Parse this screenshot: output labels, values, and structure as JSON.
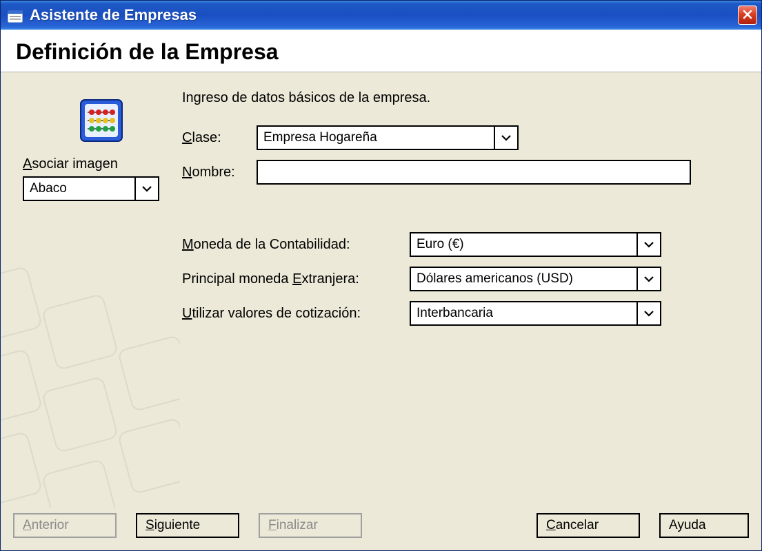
{
  "window": {
    "title": "Asistente de Empresas"
  },
  "header": {
    "heading": "Definición de la Empresa"
  },
  "content": {
    "subtitle": "Ingreso de datos básicos de la empresa.",
    "associate_image": {
      "label_pre": "A",
      "label_rest": "sociar imagen",
      "value": "Abaco",
      "icon_name": "abacus-icon"
    },
    "clase": {
      "label_pre": "C",
      "label_rest": "lase:",
      "value": "Empresa Hogareña"
    },
    "nombre": {
      "label_pre": "N",
      "label_rest": "ombre:",
      "value": ""
    },
    "moneda_contabilidad": {
      "label_pre": "M",
      "label_rest": "oneda de la Contabilidad:",
      "value": "Euro (€)"
    },
    "moneda_extranjera": {
      "label_text": "Principal moneda ",
      "label_ul": "E",
      "label_post": "xtranjera:",
      "value": "Dólares americanos (USD)"
    },
    "cotizacion": {
      "label_pre": "U",
      "label_rest": "tilizar valores de cotización:",
      "value": "Interbancaria"
    }
  },
  "buttons": {
    "anterior": {
      "ul": "A",
      "rest": "nterior",
      "enabled": false
    },
    "siguiente": {
      "ul": "S",
      "rest": "iguiente",
      "enabled": true
    },
    "finalizar": {
      "ul": "F",
      "rest": "inalizar",
      "enabled": false
    },
    "cancelar": {
      "ul": "C",
      "rest": "ancelar",
      "enabled": true
    },
    "ayuda": {
      "ul": "",
      "rest": "Ayuda",
      "enabled": true
    }
  }
}
